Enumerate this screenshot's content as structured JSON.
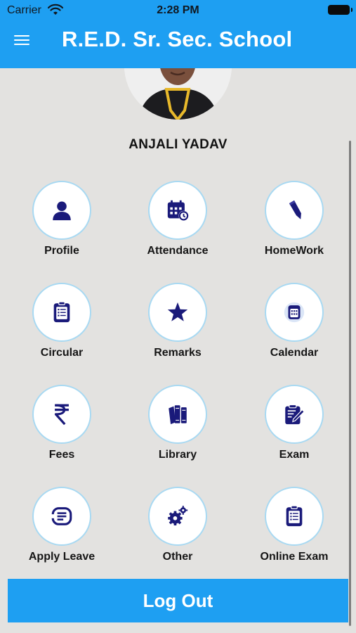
{
  "status_bar": {
    "carrier": "Carrier",
    "time": "2:28 PM"
  },
  "header": {
    "title": "R.E.D. Sr. Sec. School"
  },
  "student": {
    "name": "ANJALI YADAV"
  },
  "menu": {
    "profile": "Profile",
    "attendance": "Attendance",
    "homework": "HomeWork",
    "circular": "Circular",
    "remarks": "Remarks",
    "calendar": "Calendar",
    "fees": "Fees",
    "library": "Library",
    "exam": "Exam",
    "apply_leave": "Apply Leave",
    "other": "Other",
    "online_exam": "Online Exam"
  },
  "icons": {
    "profile": "person-icon",
    "attendance": "calendar-clock-icon",
    "homework": "pencil-icon",
    "circular": "notice-list-icon",
    "remarks": "star-icon",
    "calendar": "calendar-icon",
    "fees": "rupee-icon",
    "library": "books-icon",
    "exam": "exam-edit-icon",
    "apply_leave": "leave-doc-icon",
    "other": "gears-icon",
    "online_exam": "clipboard-icon"
  },
  "logout": {
    "label": "Log Out"
  },
  "colors": {
    "primary": "#1e9ff2",
    "icon": "#1a1a7a",
    "background": "#e3e2e0",
    "tile_border": "#a8d9f2"
  }
}
